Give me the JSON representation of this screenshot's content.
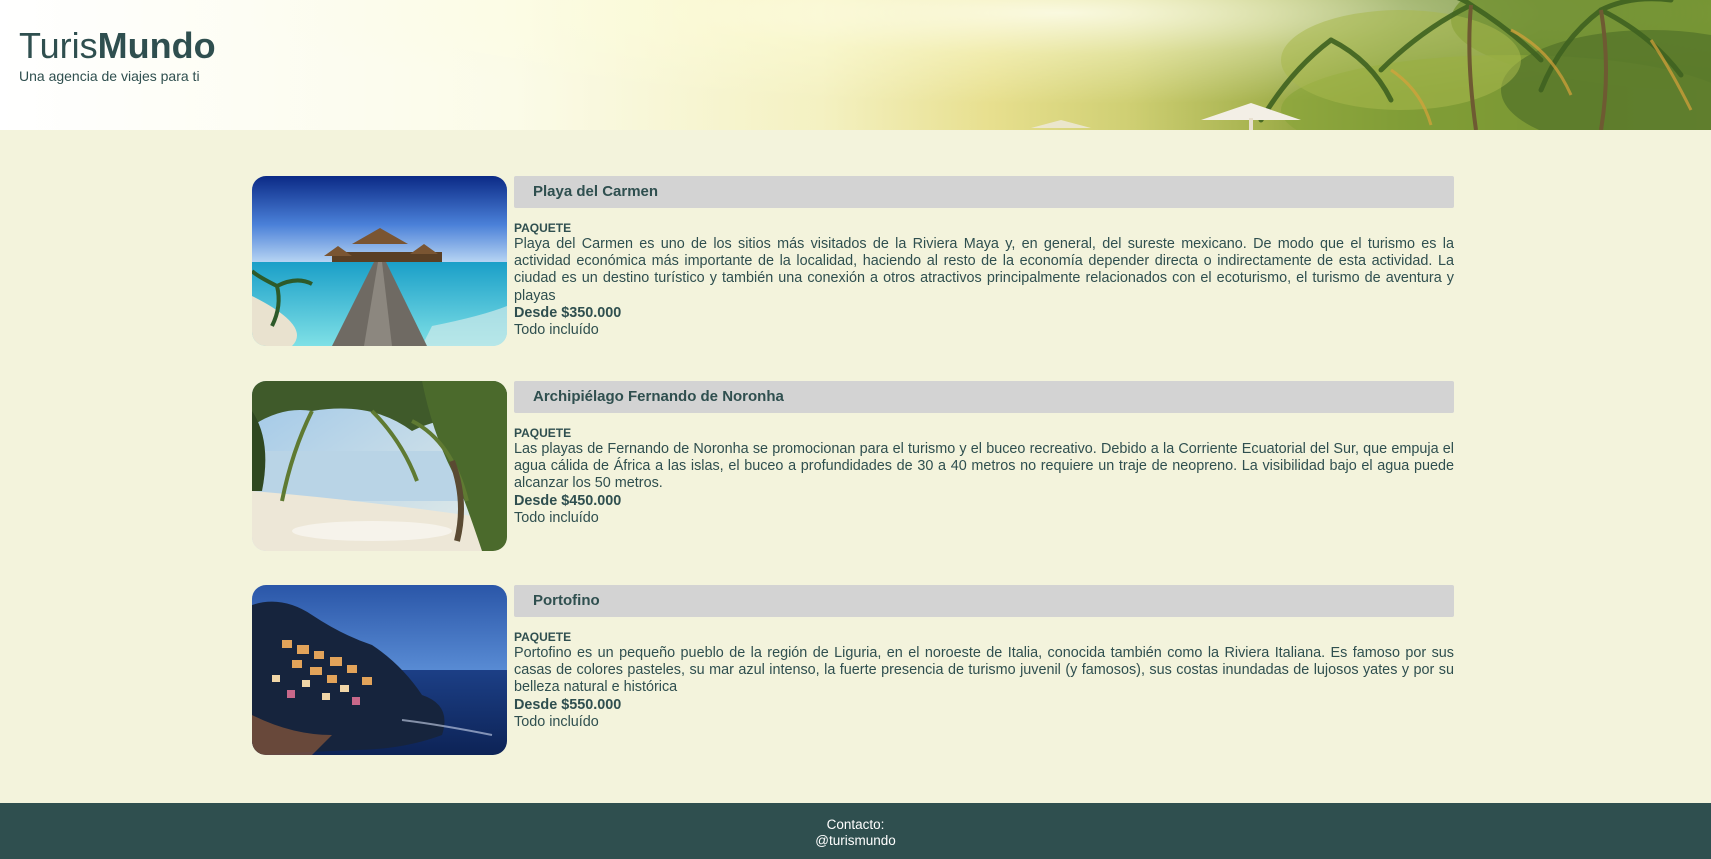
{
  "header": {
    "brand_light": "Turis",
    "brand_bold": "Mundo",
    "tagline": "Una agencia de viajes para ti"
  },
  "packages": [
    {
      "title": "Playa del Carmen",
      "kind": "PAQUETE",
      "description": "Playa del Carmen es uno de los sitios más visitados de la Riviera Maya y, en general, del sureste mexicano. De modo que el turismo es la actividad económica más importante de la localidad, haciendo al resto de la economía depender directa o indirectamente de esta actividad. La ciudad es un destino turístico y también una conexión a otros atractivos principalmente relacionados con el ecoturismo, el turismo de aventura y playas",
      "price": "Desde $350.000",
      "includes": "Todo incluído"
    },
    {
      "title": "Archipiélago Fernando de Noronha",
      "kind": "PAQUETE",
      "description": "Las playas de Fernando de Noronha se promocionan para el turismo y el buceo recreativo. Debido a la Corriente Ecuatorial del Sur, que empuja el agua cálida de África a las islas, el buceo a profundidades de 30 a 40 metros no requiere un traje de neopreno. La visibilidad bajo el agua puede alcanzar los 50 metros.",
      "price": "Desde $450.000",
      "includes": "Todo incluído"
    },
    {
      "title": "Portofino",
      "kind": "PAQUETE",
      "description": "Portofino es un pequeño pueblo de la región de Liguria, en el noroeste de Italia, conocida también como la Riviera Italiana. Es famoso por sus casas de colores pasteles, su mar azul intenso, la fuerte presencia de turismo juvenil (y famosos), sus costas inundadas de lujosos yates y por su belleza natural e histórica",
      "price": "Desde $550.000",
      "includes": "Todo incluído"
    }
  ],
  "footer": {
    "contact_label": "Contacto:",
    "handle": "@turismundo"
  }
}
